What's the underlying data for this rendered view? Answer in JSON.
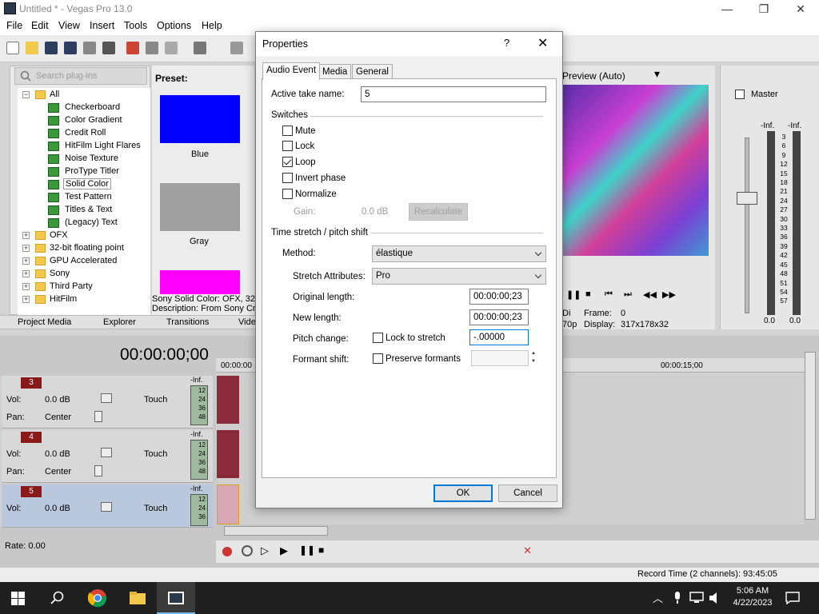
{
  "window": {
    "title": "Untitled * - Vegas Pro 13.0"
  },
  "menu": [
    "File",
    "Edit",
    "View",
    "Insert",
    "Tools",
    "Options",
    "Help"
  ],
  "plugins": {
    "search_placeholder": "Search plug-ins",
    "preset_label": "Preset:",
    "tree": [
      {
        "label": "All",
        "level": 0,
        "folder": true,
        "expander": "−"
      },
      {
        "label": "Checkerboard",
        "level": 1
      },
      {
        "label": "Color Gradient",
        "level": 1
      },
      {
        "label": "Credit Roll",
        "level": 1
      },
      {
        "label": "HitFilm Light Flares",
        "level": 1
      },
      {
        "label": "Noise Texture",
        "level": 1
      },
      {
        "label": "ProType Titler",
        "level": 1
      },
      {
        "label": "Solid Color",
        "level": 1,
        "selected": true
      },
      {
        "label": "Test Pattern",
        "level": 1
      },
      {
        "label": "Titles & Text",
        "level": 1
      },
      {
        "label": "(Legacy) Text",
        "level": 1
      },
      {
        "label": "OFX",
        "level": 0,
        "folder": true,
        "expander": "+"
      },
      {
        "label": "32-bit floating point",
        "level": 0,
        "folder": true,
        "expander": "+"
      },
      {
        "label": "GPU Accelerated",
        "level": 0,
        "folder": true,
        "expander": "+"
      },
      {
        "label": "Sony",
        "level": 0,
        "folder": true,
        "expander": "+"
      },
      {
        "label": "Third Party",
        "level": 0,
        "folder": true,
        "expander": "+"
      },
      {
        "label": "HitFilm",
        "level": 0,
        "folder": true,
        "expander": "+"
      }
    ],
    "presets": [
      {
        "name": "Blue",
        "color": "#0000ff"
      },
      {
        "name": "Gray",
        "color": "#a0a0a0"
      },
      {
        "name": "",
        "color": "#ff00ff"
      }
    ],
    "description_line1": "Sony Solid Color: OFX, 32-",
    "description_line2": "Description: From Sony Cre"
  },
  "window_tabs": [
    "Project Media",
    "Explorer",
    "Transitions",
    "Vide"
  ],
  "preview": {
    "mode": "Preview (Auto)",
    "frame_label": "Frame:",
    "frame_value": "0",
    "display_label": "Display:",
    "display_value": "317x178x32",
    "res_fragment": "70p",
    "di_fragment": "Di"
  },
  "mixer": {
    "master_label": "Master",
    "inf_left": "-Inf.",
    "inf_right": "-Inf.",
    "scale": [
      "3",
      "6",
      "9",
      "12",
      "15",
      "18",
      "21",
      "24",
      "27",
      "30",
      "33",
      "36",
      "39",
      "42",
      "45",
      "48",
      "51",
      "54",
      "57"
    ],
    "bottom_left": "0.0",
    "bottom_right": "0.0"
  },
  "timeline": {
    "timecode": "00:00:00;00",
    "ruler_start": "00:00:00",
    "ruler_15": "00:00:15;00",
    "tracks": [
      {
        "num": "3",
        "vol_label": "Vol:",
        "vol": "0.0 dB",
        "pan_label": "Pan:",
        "pan": "Center",
        "mode": "Touch",
        "inf": "-Inf."
      },
      {
        "num": "4",
        "vol_label": "Vol:",
        "vol": "0.0 dB",
        "pan_label": "Pan:",
        "pan": "Center",
        "mode": "Touch",
        "inf": "-Inf."
      },
      {
        "num": "5",
        "vol_label": "Vol:",
        "vol": "0.0 dB",
        "pan_label": "Pan:",
        "pan": "Center",
        "mode": "Touch",
        "inf": "-Inf."
      }
    ],
    "meter_ticks": [
      "12",
      "24",
      "36",
      "48"
    ],
    "rate": "Rate: 0.00",
    "record_time": "Record Time (2 channels): 93:45:05"
  },
  "taskbar": {
    "time": "5:06 AM",
    "date": "4/22/2023"
  },
  "dialog": {
    "title": "Properties",
    "help": "?",
    "close": "✕",
    "tabs": [
      "Audio Event",
      "Media",
      "General"
    ],
    "active_take_label": "Active take name:",
    "active_take_value": "5",
    "switches_label": "Switches",
    "switches": [
      {
        "label": "Mute",
        "checked": false
      },
      {
        "label": "Lock",
        "checked": false
      },
      {
        "label": "Loop",
        "checked": true
      },
      {
        "label": "Invert phase",
        "checked": false
      },
      {
        "label": "Normalize",
        "checked": false
      }
    ],
    "gain_label": "Gain:",
    "gain_value": "0.0 dB",
    "recalculate": "Recalculate",
    "stretch_group": "Time stretch / pitch shift",
    "method_label": "Method:",
    "method_value": "élastique",
    "stretch_attr_label": "Stretch Attributes:",
    "stretch_attr_value": "Pro",
    "orig_len_label": "Original length:",
    "orig_len_value": "00:00:00;23",
    "new_len_label": "New length:",
    "new_len_value": "00:00:00;23",
    "pitch_label": "Pitch change:",
    "lock_stretch_label": "Lock to stretch",
    "pitch_value": "-.00000",
    "formant_label": "Formant shift:",
    "preserve_formants_label": "Preserve formants",
    "ok": "OK",
    "cancel": "Cancel"
  }
}
